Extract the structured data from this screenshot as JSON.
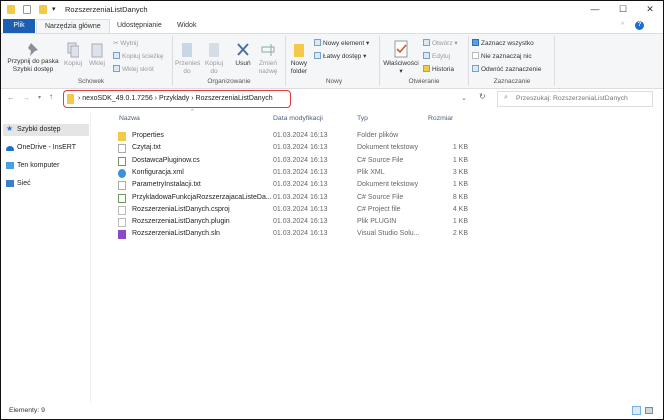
{
  "window": {
    "title": "RozszerzeniaListDanych",
    "minimize": "—",
    "maximize": "☐",
    "close": "✕",
    "help": "?"
  },
  "tabs": [
    {
      "label": "Plik"
    },
    {
      "label": "Narzędzia główne"
    },
    {
      "label": "Udostępnianie"
    },
    {
      "label": "Widok"
    }
  ],
  "ribbon": {
    "schowek": {
      "label": "Schowek",
      "pin": "Przypnij do paska Szybki dostęp",
      "copy": "Kopiuj",
      "paste": "Wklej",
      "cut": "Wytnij",
      "copy_path": "Kopiuj ścieżkę",
      "paste_shortcut": "Wklej skrót"
    },
    "organizowanie": {
      "label": "Organizowanie",
      "move": "Przenieś do",
      "copy_to": "Kopiuj do",
      "delete": "Usuń",
      "rename": "Zmień nazwę"
    },
    "nowy": {
      "label": "Nowy",
      "new_folder": "Nowy folder",
      "new_item": "Nowy element ▾",
      "easy_access": "Łatwy dostęp ▾"
    },
    "otwieranie": {
      "label": "Otwieranie",
      "properties": "Właściwości",
      "open": "Otwórz ▾",
      "edit": "Edytuj",
      "history": "Historia"
    },
    "zaznaczanie": {
      "label": "Zaznaczanie",
      "select_all": "Zaznacz wszystko",
      "select_none": "Nie zaznaczaj nic",
      "invert": "Odwróć zaznaczenie"
    }
  },
  "address": {
    "crumbs": [
      "nexoSDK_49.0.1.7256",
      "Przyklady",
      "RozszerzeniaListDanych"
    ],
    "search_placeholder": "Przeszukaj: RozszerzeniaListDanych"
  },
  "nav": [
    {
      "label": "Szybki dostęp"
    },
    {
      "label": "OneDrive - InsERT"
    },
    {
      "label": "Ten komputer"
    },
    {
      "label": "Sieć"
    }
  ],
  "columns": {
    "name": "Nazwa",
    "date": "Data modyfikacji",
    "type": "Typ",
    "size": "Rozmiar"
  },
  "files": [
    {
      "name": "Properties",
      "date": "01.03.2024 16:13",
      "type": "Folder plików",
      "size": "",
      "icon": "folder"
    },
    {
      "name": "Czytaj.txt",
      "date": "01.03.2024 16:13",
      "type": "Dokument tekstowy",
      "size": "1 KB",
      "icon": "text"
    },
    {
      "name": "DostawcaPluginow.cs",
      "date": "01.03.2024 16:13",
      "type": "C# Source File",
      "size": "1 KB",
      "icon": "cs"
    },
    {
      "name": "Konfiguracja.xml",
      "date": "01.03.2024 16:13",
      "type": "Plik XML",
      "size": "3 KB",
      "icon": "xml"
    },
    {
      "name": "ParametryInstalacji.txt",
      "date": "01.03.2024 16:13",
      "type": "Dokument tekstowy",
      "size": "1 KB",
      "icon": "text"
    },
    {
      "name": "PrzykladowaFunkcjaRozszerzajacaListeDa...",
      "date": "01.03.2024 16:13",
      "type": "C# Source File",
      "size": "8 KB",
      "icon": "cs"
    },
    {
      "name": "RozszerzeniaListDanych.csproj",
      "date": "01.03.2024 16:13",
      "type": "C# Project file",
      "size": "4 KB",
      "icon": "file"
    },
    {
      "name": "RozszerzeniaListDanych.plugin",
      "date": "01.03.2024 16:13",
      "type": "Plik PLUGIN",
      "size": "1 KB",
      "icon": "file"
    },
    {
      "name": "RozszerzeniaListDanych.sln",
      "date": "01.03.2024 16:13",
      "type": "Visual Studio Solu...",
      "size": "2 KB",
      "icon": "sln"
    }
  ],
  "status": {
    "count": "Elementy: 9"
  }
}
